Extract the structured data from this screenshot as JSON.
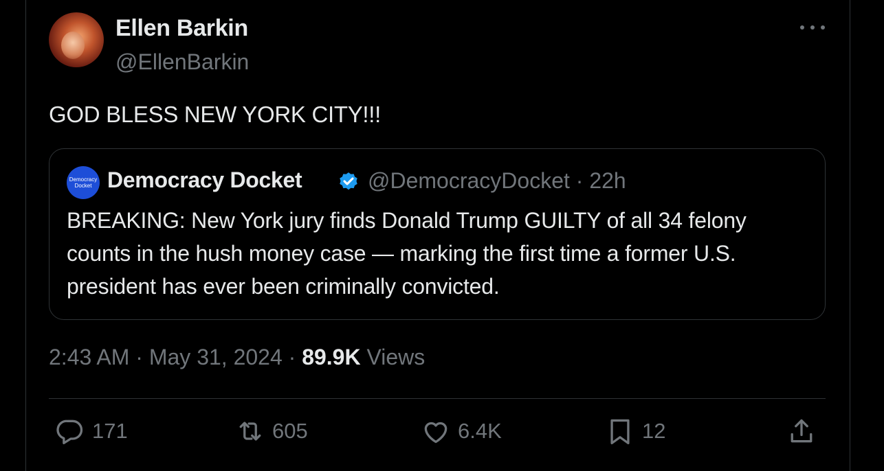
{
  "author": {
    "display_name": "Ellen Barkin",
    "handle": "@EllenBarkin"
  },
  "tweet": {
    "text": "GOD BLESS NEW YORK CITY!!!"
  },
  "quote": {
    "logo_text_line1": "Democracy",
    "logo_text_line2": "Docket",
    "display_name": "Democracy Docket",
    "handle_time": "@DemocracyDocket · 22h",
    "text": "BREAKING: New York jury finds Donald Trump GUILTY of all 34 felony counts in the hush money case — marking the first time a former U.S. president has ever been criminally convicted."
  },
  "meta": {
    "time": "2:43 AM",
    "separator1": " · ",
    "date": "May 31, 2024",
    "separator2": " · ",
    "views_count": "89.9K",
    "views_label": " Views"
  },
  "actions": {
    "replies": "171",
    "retweets": "605",
    "likes": "6.4K",
    "bookmarks": "12"
  },
  "icons": {
    "more": "more-horizontal-icon",
    "verified": "verified-badge-icon",
    "reply": "reply-icon",
    "retweet": "retweet-icon",
    "like": "heart-icon",
    "bookmark": "bookmark-icon",
    "share": "share-icon"
  },
  "colors": {
    "background": "#000000",
    "text": "#e7e9ea",
    "muted": "#71767b",
    "verified": "#1d9bf0",
    "border": "#2f3336"
  }
}
